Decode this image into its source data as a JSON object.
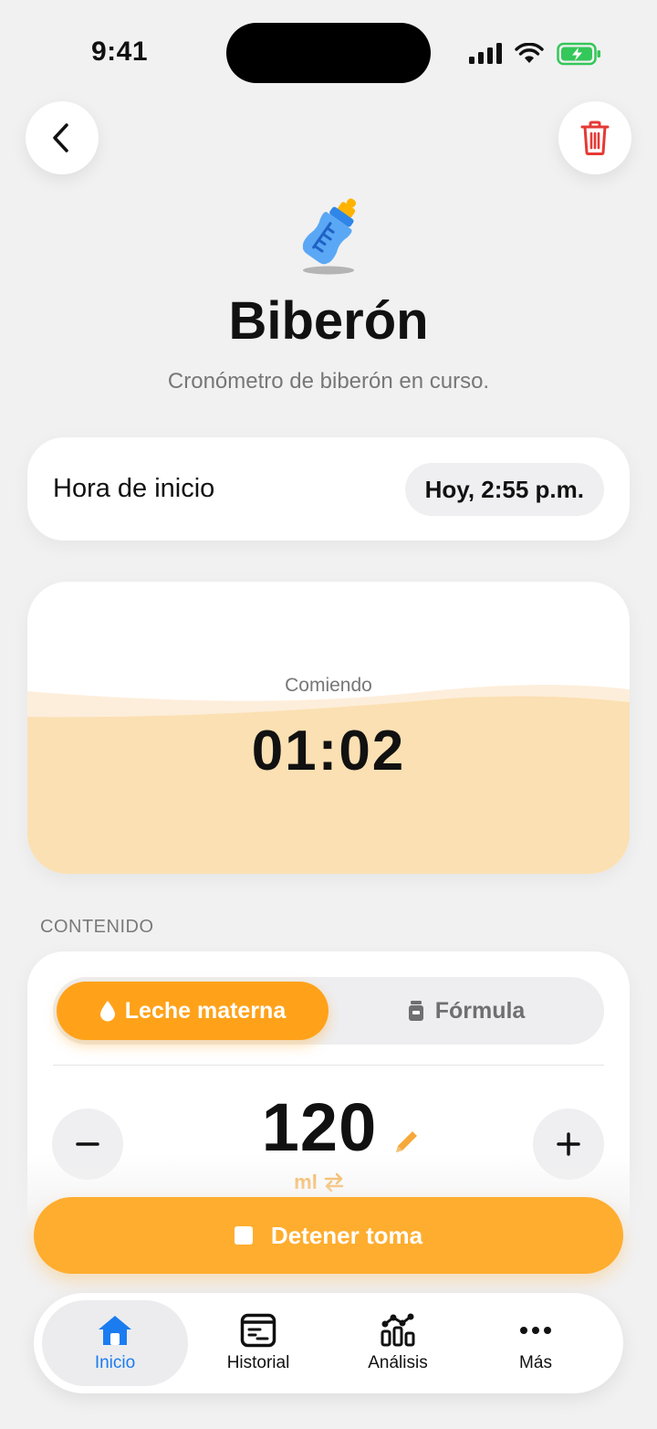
{
  "status_bar": {
    "time": "9:41"
  },
  "header": {
    "title": "Biberón",
    "subtitle": "Cronómetro de biberón en curso."
  },
  "start_time": {
    "label": "Hora de inicio",
    "value": "Hoy, 2:55 p.m."
  },
  "timer": {
    "label": "Comiendo",
    "value": "01:02"
  },
  "content": {
    "section_label": "CONTENIDO",
    "options": [
      {
        "label": "Leche materna",
        "selected": true
      },
      {
        "label": "Fórmula",
        "selected": false
      }
    ],
    "amount": "120",
    "unit": "ml"
  },
  "stop_button": {
    "label": "Detener toma"
  },
  "tabs": [
    {
      "label": "Inicio",
      "active": true
    },
    {
      "label": "Historial",
      "active": false
    },
    {
      "label": "Análisis",
      "active": false
    },
    {
      "label": "Más",
      "active": false
    }
  ],
  "colors": {
    "accent": "#ffa21a",
    "tab_active": "#1b7cf0",
    "delete": "#e53935",
    "battery": "#34c759",
    "timer_fill": "#fbe0b3"
  }
}
